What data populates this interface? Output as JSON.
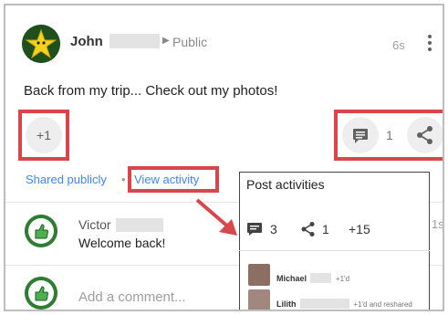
{
  "post": {
    "author": "John",
    "privacy": "Public",
    "time": "6s",
    "text": "Back from my trip... Check out my photos!",
    "plus_label": "+1",
    "comment_count": "1",
    "shared_label": "Shared publicly",
    "separator": "•",
    "view_activity_label": "View activity"
  },
  "comments": [
    {
      "name": "Victor",
      "text": "Welcome back!",
      "time": "1s"
    }
  ],
  "add_comment_placeholder": "Add a comment...",
  "popup": {
    "title": "Post activities",
    "comments_count": "3",
    "shares_count": "1",
    "plus_count": "+15",
    "activities": [
      {
        "name": "Michael",
        "action": "+1'd"
      },
      {
        "name": "Lilith",
        "action": "+1'd and reshared"
      }
    ]
  },
  "colors": {
    "highlight": "#d7474b",
    "link": "#4285f4"
  },
  "icons": [
    "star-avatar-icon",
    "caret-right-icon",
    "more-vert-icon",
    "comment-icon",
    "share-icon",
    "thumbs-up-avatar-icon",
    "arrow-pointer-icon"
  ]
}
